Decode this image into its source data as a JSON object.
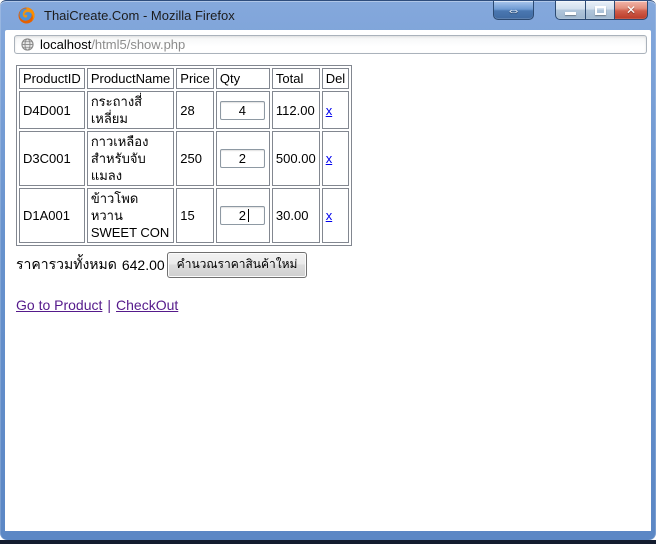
{
  "window": {
    "title": "ThaiCreate.Com - Mozilla Firefox",
    "controls": {
      "restore_glyph": "⇔",
      "close_glyph": "✕"
    }
  },
  "address": {
    "domain": "localhost",
    "path": "/html5/show.php"
  },
  "cart": {
    "columns": [
      "ProductID",
      "ProductName",
      "Price",
      "Qty",
      "Total",
      "Del"
    ],
    "products": [
      {
        "id": "D4D001",
        "name": "กระถางสี่\nเหลี่ยม",
        "price": "28",
        "qty": "4",
        "total": "112.00",
        "del": "x",
        "focused": false
      },
      {
        "id": "D3C001",
        "name": "กาวเหลือง\nสำหรับจับ\nแมลง",
        "price": "250",
        "qty": "2",
        "total": "500.00",
        "del": "x",
        "focused": false
      },
      {
        "id": "D1A001",
        "name": "ข้าวโพดหวาน\nSWEET CON",
        "price": "15",
        "qty": "2",
        "total": "30.00",
        "del": "x",
        "focused": true
      }
    ]
  },
  "summary": {
    "label": "ราคารวมทั้งหมด",
    "total": "642.00",
    "button_label": "คำนวณราคาสินค้าใหม่"
  },
  "links": {
    "items": [
      {
        "label": "Go to Product"
      },
      {
        "label": "CheckOut"
      }
    ],
    "separator": "|"
  },
  "colors": {
    "titlebar_blue": "#5b87c5",
    "close_button_red": "#c6422f",
    "link_blue": "#0000EE",
    "visited_link_purple": "#551A8B",
    "table_border_gray": "#828790",
    "desktop_edge_dark": "#131c2e"
  }
}
